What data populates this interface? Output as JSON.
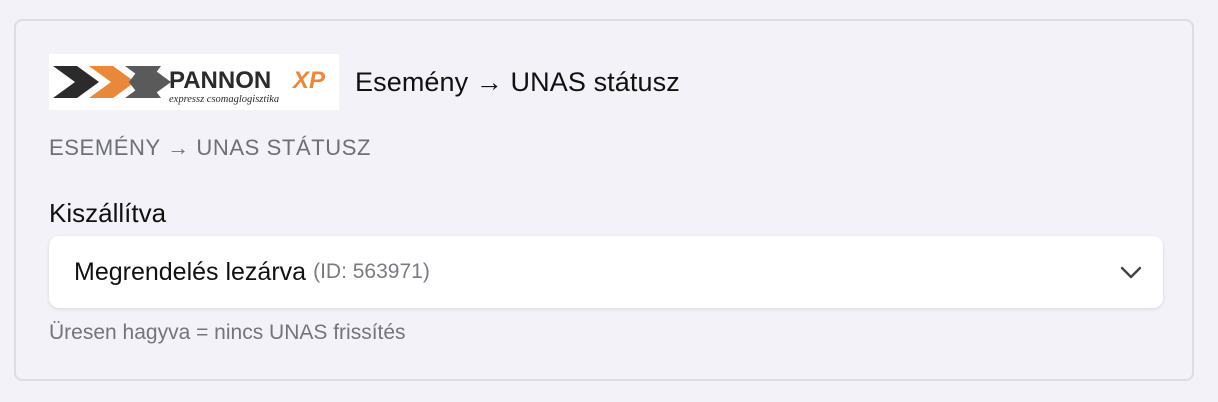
{
  "header": {
    "logo": {
      "brand_text": "PANNON",
      "brand_suffix": "XP",
      "tagline": "expressz csomaglogisztika",
      "colors": {
        "orange": "#e8883a",
        "gray": "#5a5a5a",
        "dark": "#2b2b2b"
      }
    },
    "title": "Esemény → UNAS státusz"
  },
  "section": {
    "label": "ESEMÉNY → UNAS STÁTUSZ"
  },
  "field": {
    "label": "Kiszállítva",
    "select": {
      "value": "Megrendelés lezárva",
      "id_text": "(ID: 563971)",
      "icon": "chevron-down-icon"
    },
    "hint": "Üresen hagyva = nincs UNAS frissítés"
  }
}
